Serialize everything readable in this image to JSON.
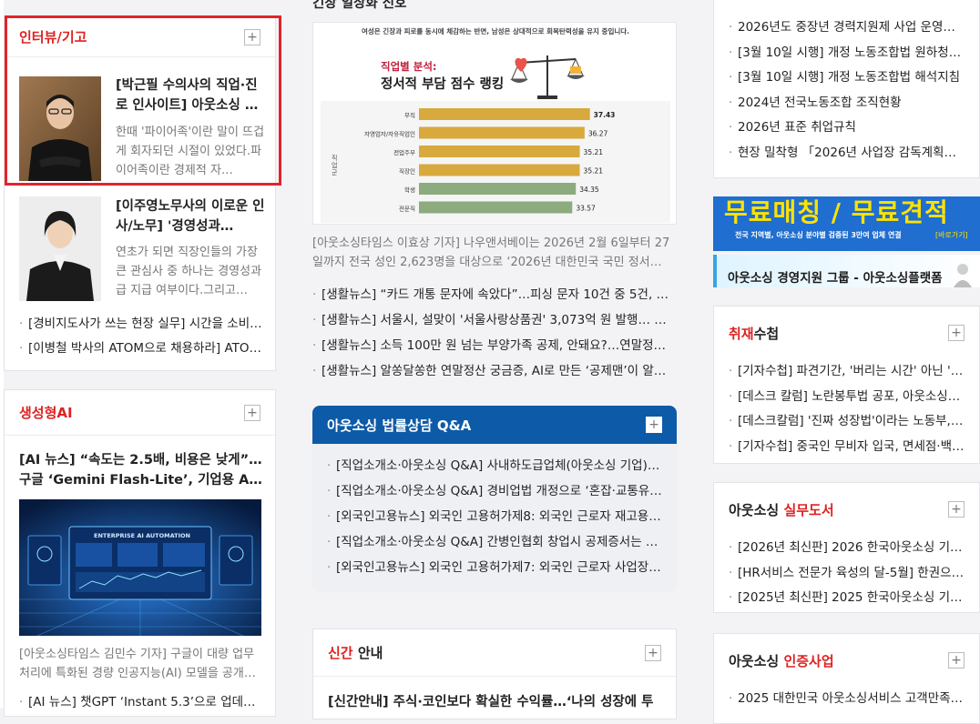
{
  "left": {
    "interview": {
      "title": "인터뷰/기고",
      "articles": [
        {
          "title": "[박근필 수의사의 직업·진로 인사이트] 아웃소싱 …",
          "summary": "한때 '파이어족'이란 말이 뜨겁게 회자되던 시절이 있었다.파이어족이란 경제적 자…"
        },
        {
          "title": "[이주영노무사의 이로운 인사/노무] '경영성과…",
          "summary": "연초가 되면 직장인들의 가장 큰 관심사 중 하나는 경영성과급 지급 여부이다.그리고…"
        }
      ],
      "items": [
        "[경비지도사가 쓰는 현장 실무] 시간을 소비…",
        "[이병철 박사의 ATOM으로 채용하라] ATO…"
      ]
    },
    "ai": {
      "title": "생성형AI",
      "headline": "[AI 뉴스] “속도는 2.5배, 비용은 낮게”… 구글 ‘Gemini Flash-Lite’, 기업용 AI 시장 …",
      "image_text": "ENTERPRISE AI AUTOMATION",
      "summary": "[아웃소싱타임스 김민수 기자] 구글이 대량 업무 처리에 특화된 경량 인공지능(AI) 모델을 공개…",
      "items": [
        "[AI 뉴스] 챗GPT ‘Instant 5.3’으로 업데이트…"
      ]
    }
  },
  "center": {
    "top_heading": "긴장 일상화 신호",
    "chart": {
      "caption": "여성은 긴장과 피로를 동시에 체감하는 반면, 남성은 상대적으로 회복탄력성을 유지 중입니다.",
      "tag": "직업별 분석:",
      "title": "정서적 부담 점수 랭킹",
      "ylabel": "직업군",
      "chart_data": {
        "type": "bar",
        "orientation": "horizontal",
        "categories": [
          "무직",
          "자영업자/자유직업인",
          "전업주부",
          "직장인",
          "학생",
          "전문직"
        ],
        "values": [
          37.43,
          36.27,
          35.21,
          35.21,
          34.35,
          33.57
        ],
        "title": "정서적 부담 점수 랭킹",
        "ylabel": "직업군",
        "colors": [
          "#d8a93c",
          "#d8a93c",
          "#d8a93c",
          "#d8a93c",
          "#8cab7e",
          "#8cab7e"
        ]
      }
    },
    "summary": "[아웃소싱타임스 이효상 기자] 나우앤서베이는 2026년 2월 6일부터 27일까지 전국 성인 2,623명을 대상으로 ‘2026년 대한민국 국민 정서 상…",
    "news": [
      "[생활뉴스] “카드 개통 문자에 속았다”…피싱 문자 10건 중 5건, 금융…",
      "[생활뉴스] 서울시, 설맞이 '서울사랑상품권' 3,073억 원 발행… 최대…",
      "[생활뉴스] 소득 100만 원 넘는 부양가족 공제, 안돼요?…연말정산 오…",
      "[생활뉴스] 알쏭달쏭한 연말정산 궁금증, AI로 만든 ‘공제맨’이 알려줍…"
    ],
    "qa": {
      "title": "아웃소싱 법률상담 Q&A",
      "items": [
        "[직업소개소·아웃소싱 Q&A] 사내하도급업체(아웃소싱 기업)와…",
        "[직업소개소·아웃소싱 Q&A] 경비업법 개정으로 ‘혼잡·교통유도…",
        "[외국인고용뉴스] 외국인 고용허가제8: 외국인 근로자 재고용·…",
        "[직업소개소·아웃소싱 Q&A] 간병인협회 창업시 공제증서는 어…",
        "[외국인고용뉴스] 외국인 고용허가제7: 외국인 근로자 사업장 …"
      ]
    },
    "newbook": {
      "title_red": "신간",
      "title_rest": " 안내",
      "headline": "[신간안내] 주식·코인보다 확실한 수익률…‘나의 성장에 투"
    }
  },
  "right": {
    "top_items": [
      "2026년도 중장년 경력지원제 사업 운영매…",
      "[3월 10일 시행] 개정 노동조합법 원하청 상…",
      "[3월 10일 시행] 개정 노동조합법 해석지침",
      "2024년 전국노동조합 조직현황",
      "2026년 표준 취업규칙",
      "현장 밀착형 「2026년 사업장 감독계획」 …"
    ],
    "banner1": {
      "main": "무료매칭 / 무료견적",
      "sub": "전국 지역별, 아웃소싱 분야별 검증된 3만여 업체 연결",
      "link": "[바로가기]"
    },
    "banner2": {
      "text": "아웃소싱 경영지원 그룹 - 아웃소싱플랫폼"
    },
    "interview": {
      "title_red": "취재",
      "title_rest": "수첩",
      "items": [
        "[기자수첩] 파견기간, '버리는 시간' 아닌 '쌓…",
        "[데스크 칼럼] 노란봉투법 공포, 아웃소싱업…",
        "[데스크칼럼] '진짜 성장법'이라는 노동부, …",
        "[기자수첩] 중국인 무비자 입국, 면세점·백화…"
      ]
    },
    "books": {
      "title_rest": "아웃소싱 ",
      "title_red": "실무도서",
      "items": [
        "[2026년 최신판] 2026 한국아웃소싱 기업…",
        "[HR서비스 전문가 육성의 달-5월] 한권으로…",
        "[2025년 최신판] 2025 한국아웃소싱 기업…"
      ]
    },
    "cert": {
      "title_rest": "아웃소싱 ",
      "title_red": "인증사업",
      "items": [
        "2025 대한민국 아웃소싱서비스 고객만족대…"
      ]
    }
  },
  "colors": {
    "accent_red": "#e0242c",
    "qa_blue": "#0d5ba8",
    "banner_blue": "#1f6ed0",
    "banner_yellow": "#ffe200"
  }
}
